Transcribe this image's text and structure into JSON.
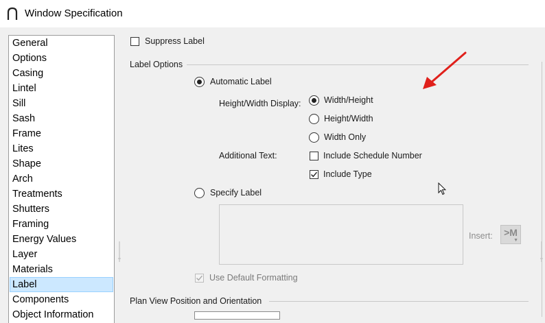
{
  "window": {
    "title": "Window Specification"
  },
  "sidebar": {
    "items": [
      {
        "label": "General",
        "selected": false
      },
      {
        "label": "Options",
        "selected": false
      },
      {
        "label": "Casing",
        "selected": false
      },
      {
        "label": "Lintel",
        "selected": false
      },
      {
        "label": "Sill",
        "selected": false
      },
      {
        "label": "Sash",
        "selected": false
      },
      {
        "label": "Frame",
        "selected": false
      },
      {
        "label": "Lites",
        "selected": false
      },
      {
        "label": "Shape",
        "selected": false
      },
      {
        "label": "Arch",
        "selected": false
      },
      {
        "label": "Treatments",
        "selected": false
      },
      {
        "label": "Shutters",
        "selected": false
      },
      {
        "label": "Framing",
        "selected": false
      },
      {
        "label": "Energy Values",
        "selected": false
      },
      {
        "label": "Layer",
        "selected": false
      },
      {
        "label": "Materials",
        "selected": false
      },
      {
        "label": "Label",
        "selected": true
      },
      {
        "label": "Components",
        "selected": false
      },
      {
        "label": "Object Information",
        "selected": false
      }
    ]
  },
  "panel": {
    "suppress_label": {
      "label": "Suppress Label",
      "checked": false
    },
    "label_options": {
      "heading": "Label Options",
      "automatic_label": {
        "label": "Automatic Label",
        "selected": true
      },
      "hw_display": {
        "label": "Height/Width Display:",
        "options": [
          {
            "label": "Width/Height",
            "selected": true
          },
          {
            "label": "Height/Width",
            "selected": false
          },
          {
            "label": "Width Only",
            "selected": false
          }
        ]
      },
      "additional_text": {
        "label": "Additional Text:",
        "include_schedule_number": {
          "label": "Include Schedule Number",
          "checked": false
        },
        "include_type": {
          "label": "Include Type",
          "checked": true
        }
      },
      "specify_label": {
        "label": "Specify Label",
        "selected": false
      },
      "insert": {
        "label": "Insert:",
        "button": ">M"
      },
      "use_default_formatting": {
        "label": "Use Default Formatting",
        "checked": true,
        "enabled": false
      }
    },
    "plan_view": {
      "heading": "Plan View Position and Orientation"
    }
  },
  "colors": {
    "annotation_arrow": "#e0201b",
    "selected_bg": "#cce8ff"
  }
}
